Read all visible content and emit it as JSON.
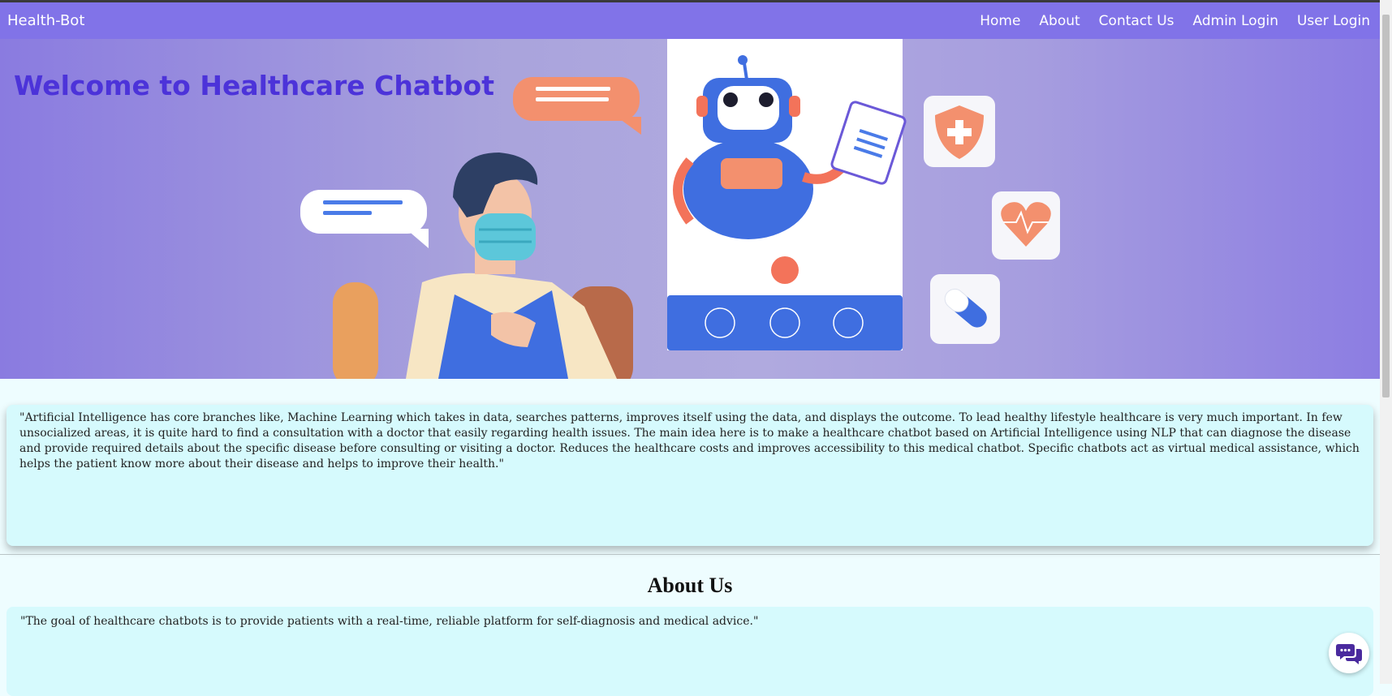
{
  "navbar": {
    "brand": "Health-Bot",
    "links": [
      "Home",
      "About",
      "Contact Us",
      "Admin Login",
      "User Login"
    ]
  },
  "hero": {
    "title": "Welcome to Healthcare Chatbot"
  },
  "intro": {
    "text": "\"Artificial Intelligence has core branches like, Machine Learning which takes in data, searches patterns, improves itself using the data, and displays the outcome. To lead healthy lifestyle healthcare is very much important. In few unsocialized areas, it is quite hard to find a consultation with a doctor that easily regarding health issues. The main idea here is to make a healthcare chatbot based on Artificial Intelligence using NLP that can diagnose the disease and provide required details about the specific disease before consulting or visiting a doctor. Reduces the healthcare costs and improves accessibility to this medical chatbot. Specific chatbots act as virtual medical assistance, which helps the patient know more about their disease and helps to improve their health.\""
  },
  "about": {
    "heading": "About Us",
    "text": "\"The goal of healthcare chatbots is to provide patients with a real-time, reliable platform for self-diagnosis and medical advice.\""
  },
  "icons": {
    "chat_widget": "chat-bubbles-icon"
  },
  "colors": {
    "navbar": "#8173e8",
    "hero_title": "#4c33d9",
    "card_bg": "#d6fafd",
    "page_bg": "#eefdff"
  }
}
